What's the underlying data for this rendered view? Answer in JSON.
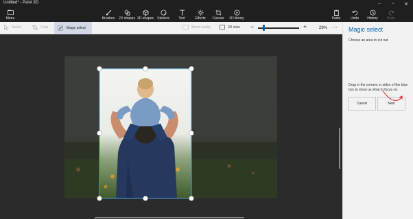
{
  "titlebar": {
    "title": "Untitled* - Paint 3D",
    "minimize_icon": "minimize-icon",
    "restore_icon": "restore-icon",
    "close_icon": "close-icon"
  },
  "ribbon": {
    "menu": "Menu",
    "brushes": "Brushes",
    "shapes_2d": "2D shapes",
    "shapes_3d": "3D shapes",
    "stickers": "Stickers",
    "text": "Text",
    "effects": "Effects",
    "canvas": "Canvas",
    "library": "3D library",
    "paste": "Paste",
    "undo": "Undo",
    "history": "History",
    "redo": "Redo"
  },
  "toolbar": {
    "select": "Select",
    "crop": "Crop",
    "magic_select": "Magic select",
    "mixed_reality": "Mixed reality",
    "view_3d": "3D view",
    "zoom_percent": "29%",
    "zoom_level": 0.29
  },
  "panel": {
    "title": "Magic select",
    "subtitle": "Choose an area to cut out",
    "hint": "Drag in the corners or sides of the blue box to show us what to focus on.",
    "cancel": "Cancel",
    "next": "Next"
  },
  "colors": {
    "accent": "#0063b1",
    "selection": "#4aa0e0",
    "annotation": "#d42020"
  }
}
